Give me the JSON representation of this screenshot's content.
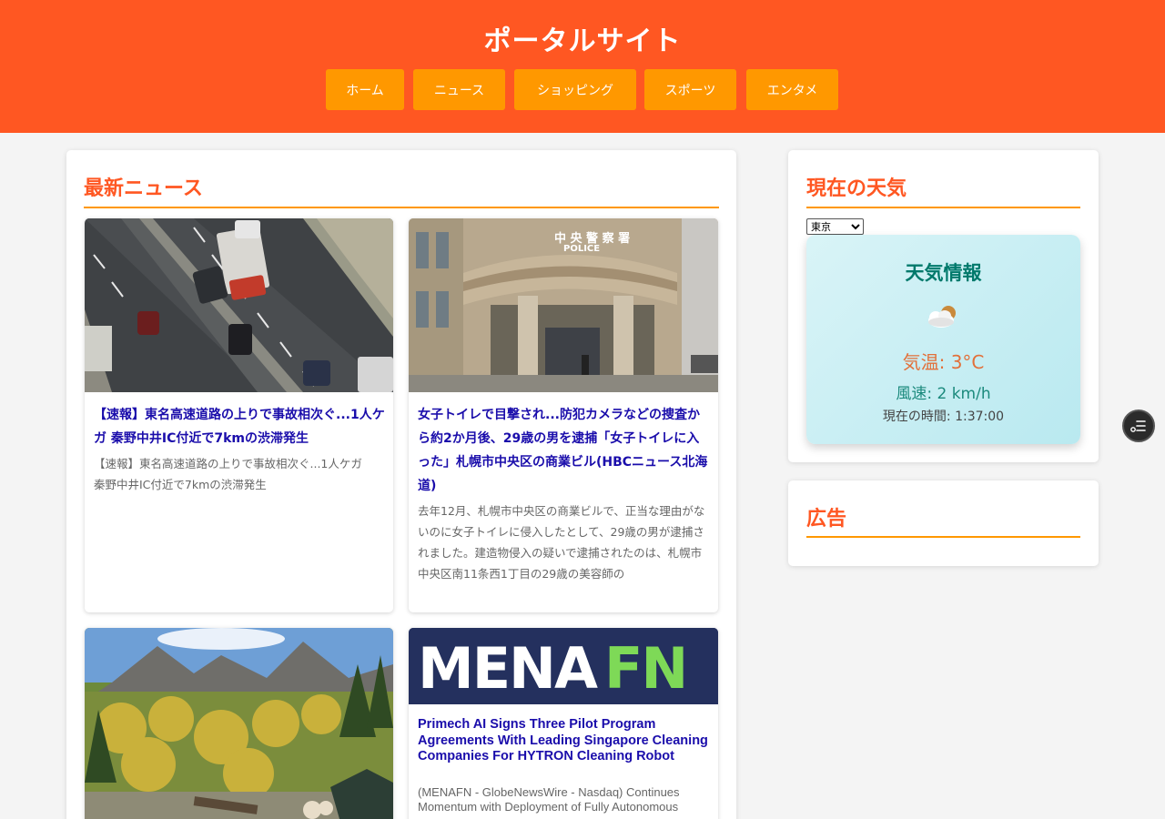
{
  "header": {
    "title": "ポータルサイト",
    "nav": [
      "ホーム",
      "ニュース",
      "ショッピング",
      "スポーツ",
      "エンタメ"
    ]
  },
  "news": {
    "title": "最新ニュース",
    "cards": [
      {
        "title": "【速報】東名高速道路の上りで事故相次ぐ...1人ケガ 秦野中井IC付近で7kmの渋滞発生",
        "desc": "【速報】東名高速道路の上りで事故相次ぐ...1人ケガ 秦野中井IC付近で7kmの渋滞発生"
      },
      {
        "title": "女子トイレで目撃され...防犯カメラなどの捜査から約2か月後、29歳の男を逮捕「女子トイレに入った」札幌市中央区の商業ビル(HBCニュース北海道)",
        "desc": "去年12月、札幌市中央区の商業ビルで、正当な理由がないのに女子トイレに侵入したとして、29歳の男が逮捕されました。建造物侵入の疑いで逮捕されたのは、札幌市中央区南11条西1丁目の29歳の美容師の",
        "sign_text": "中 央 警 察 署",
        "sign_text_en": "POLICE"
      },
      {
        "title": "",
        "desc": ""
      },
      {
        "title": "Primech AI Signs Three Pilot Program Agreements With Leading Singapore Cleaning Companies For HYTRON Cleaning Robot",
        "desc": "(MENAFN - GlobeNewsWire - Nasdaq) Continues Momentum with Deployment of Fully Autonomous",
        "logo_part1": "MENA",
        "logo_part2": "FN"
      }
    ]
  },
  "weather": {
    "title": "現在の天気",
    "city_selected": "東京",
    "card_title": "天気情報",
    "icon": "partly-cloudy-icon",
    "temp": "気温: 3°C",
    "wind": "風速: 2 km/h",
    "time": "現在の時間: 1:37:00"
  },
  "ads": {
    "title": "広告"
  },
  "colors": {
    "header": "#ff5722",
    "nav_button": "#ff9800",
    "link": "#1a0dab",
    "menafn_bg": "#24305e",
    "menafn_accent": "#7ed957"
  }
}
